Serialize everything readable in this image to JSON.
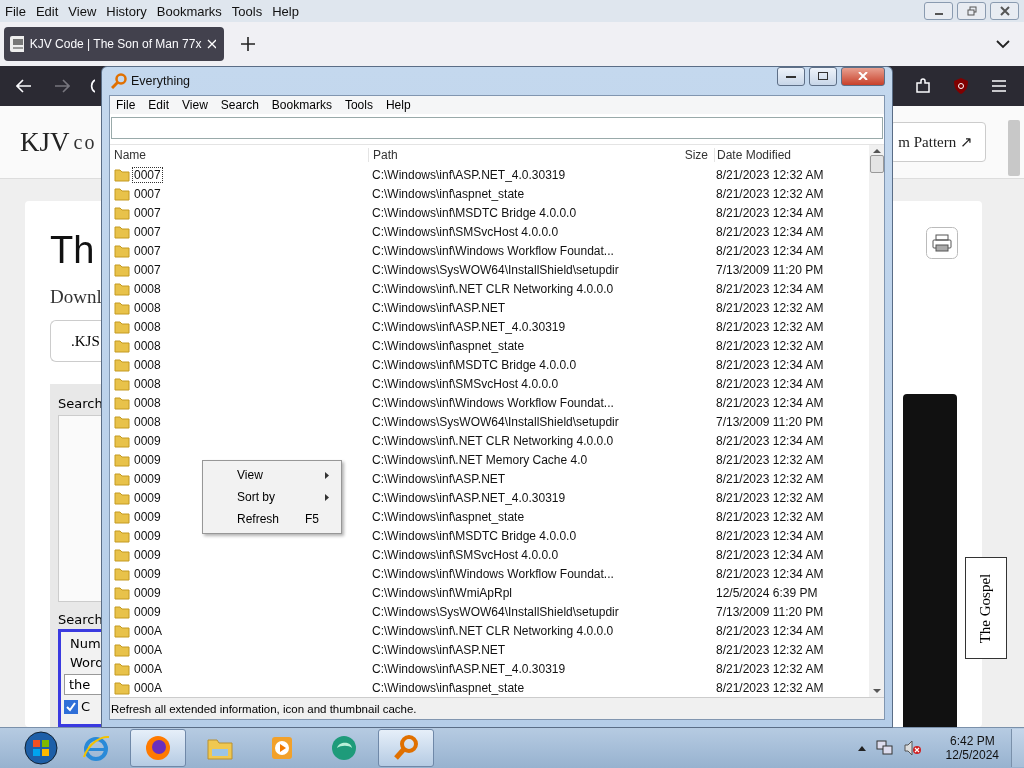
{
  "browser": {
    "menu": [
      "File",
      "Edit",
      "View",
      "History",
      "Bookmarks",
      "Tools",
      "Help"
    ],
    "tab": {
      "title": "KJV Code | The Son of Man 77x"
    },
    "page": {
      "logo": "KJV",
      "logo_rest": "co",
      "pattern_link": "m Pattern ↗",
      "heading": "Th",
      "download": "Downl",
      "kjs_button": ".KJS",
      "search_label": "Search",
      "search_label_2": "Search",
      "num_label": "Num",
      "word_label": "Word",
      "word_value": "the",
      "checkbox": {
        "label": "C",
        "checked": true
      },
      "side_tab": "The Gospel"
    }
  },
  "everything": {
    "title": "Everything",
    "menu": [
      "File",
      "Edit",
      "View",
      "Search",
      "Bookmarks",
      "Tools",
      "Help"
    ],
    "columns": [
      "Name",
      "Path",
      "Size",
      "Date Modified"
    ],
    "rows": [
      {
        "name": "0007",
        "path": "C:\\Windows\\inf\\ASP.NET_4.0.30319",
        "modified": "8/21/2023 12:32 AM",
        "selected": true
      },
      {
        "name": "0007",
        "path": "C:\\Windows\\inf\\aspnet_state",
        "modified": "8/21/2023 12:32 AM",
        "selected": false
      },
      {
        "name": "0007",
        "path": "C:\\Windows\\inf\\MSDTC Bridge 4.0.0.0",
        "modified": "8/21/2023 12:34 AM",
        "selected": false
      },
      {
        "name": "0007",
        "path": "C:\\Windows\\inf\\SMSvcHost 4.0.0.0",
        "modified": "8/21/2023 12:34 AM",
        "selected": false
      },
      {
        "name": "0007",
        "path": "C:\\Windows\\inf\\Windows Workflow Foundat...",
        "modified": "8/21/2023 12:34 AM",
        "selected": false
      },
      {
        "name": "0007",
        "path": "C:\\Windows\\SysWOW64\\InstallShield\\setupdir",
        "modified": "7/13/2009 11:20 PM",
        "selected": false
      },
      {
        "name": "0008",
        "path": "C:\\Windows\\inf\\.NET CLR Networking 4.0.0.0",
        "modified": "8/21/2023 12:34 AM",
        "selected": false
      },
      {
        "name": "0008",
        "path": "C:\\Windows\\inf\\ASP.NET",
        "modified": "8/21/2023 12:32 AM",
        "selected": false
      },
      {
        "name": "0008",
        "path": "C:\\Windows\\inf\\ASP.NET_4.0.30319",
        "modified": "8/21/2023 12:32 AM",
        "selected": false
      },
      {
        "name": "0008",
        "path": "C:\\Windows\\inf\\aspnet_state",
        "modified": "8/21/2023 12:32 AM",
        "selected": false
      },
      {
        "name": "0008",
        "path": "C:\\Windows\\inf\\MSDTC Bridge 4.0.0.0",
        "modified": "8/21/2023 12:34 AM",
        "selected": false
      },
      {
        "name": "0008",
        "path": "C:\\Windows\\inf\\SMSvcHost 4.0.0.0",
        "modified": "8/21/2023 12:34 AM",
        "selected": false
      },
      {
        "name": "0008",
        "path": "C:\\Windows\\inf\\Windows Workflow Foundat...",
        "modified": "8/21/2023 12:34 AM",
        "selected": false
      },
      {
        "name": "0008",
        "path": "C:\\Windows\\SysWOW64\\InstallShield\\setupdir",
        "modified": "7/13/2009 11:20 PM",
        "selected": false
      },
      {
        "name": "0009",
        "path": "C:\\Windows\\inf\\.NET CLR Networking 4.0.0.0",
        "modified": "8/21/2023 12:34 AM",
        "selected": false
      },
      {
        "name": "0009",
        "path": "C:\\Windows\\inf\\.NET Memory Cache 4.0",
        "modified": "8/21/2023 12:32 AM",
        "selected": false
      },
      {
        "name": "0009",
        "path": "C:\\Windows\\inf\\ASP.NET",
        "modified": "8/21/2023 12:32 AM",
        "selected": false
      },
      {
        "name": "0009",
        "path": "C:\\Windows\\inf\\ASP.NET_4.0.30319",
        "modified": "8/21/2023 12:32 AM",
        "selected": false
      },
      {
        "name": "0009",
        "path": "C:\\Windows\\inf\\aspnet_state",
        "modified": "8/21/2023 12:32 AM",
        "selected": false
      },
      {
        "name": "0009",
        "path": "C:\\Windows\\inf\\MSDTC Bridge 4.0.0.0",
        "modified": "8/21/2023 12:34 AM",
        "selected": false
      },
      {
        "name": "0009",
        "path": "C:\\Windows\\inf\\SMSvcHost 4.0.0.0",
        "modified": "8/21/2023 12:34 AM",
        "selected": false
      },
      {
        "name": "0009",
        "path": "C:\\Windows\\inf\\Windows Workflow Foundat...",
        "modified": "8/21/2023 12:34 AM",
        "selected": false
      },
      {
        "name": "0009",
        "path": "C:\\Windows\\inf\\WmiApRpl",
        "modified": "12/5/2024 6:39 PM",
        "selected": false
      },
      {
        "name": "0009",
        "path": "C:\\Windows\\SysWOW64\\InstallShield\\setupdir",
        "modified": "7/13/2009 11:20 PM",
        "selected": false
      },
      {
        "name": "000A",
        "path": "C:\\Windows\\inf\\.NET CLR Networking 4.0.0.0",
        "modified": "8/21/2023 12:34 AM",
        "selected": false
      },
      {
        "name": "000A",
        "path": "C:\\Windows\\inf\\ASP.NET",
        "modified": "8/21/2023 12:32 AM",
        "selected": false
      },
      {
        "name": "000A",
        "path": "C:\\Windows\\inf\\ASP.NET_4.0.30319",
        "modified": "8/21/2023 12:32 AM",
        "selected": false
      },
      {
        "name": "000A",
        "path": "C:\\Windows\\inf\\aspnet_state",
        "modified": "8/21/2023 12:32 AM",
        "selected": false
      }
    ],
    "status": "Refresh all extended information, icon and thumbnail cache."
  },
  "context_menu": [
    {
      "label": "View",
      "submenu": true
    },
    {
      "label": "Sort by",
      "submenu": true
    },
    {
      "label": "Refresh",
      "shortcut": "F5",
      "submenu": false
    }
  ],
  "taskbar": {
    "apps": [
      {
        "kind": "ie",
        "active": false
      },
      {
        "kind": "firefox",
        "active": true
      },
      {
        "kind": "explorer",
        "active": false
      },
      {
        "kind": "media",
        "active": false
      },
      {
        "kind": "green",
        "active": false
      },
      {
        "kind": "everything",
        "active": true
      }
    ],
    "clock": {
      "time": "6:42 PM",
      "date": "12/5/2024"
    }
  }
}
